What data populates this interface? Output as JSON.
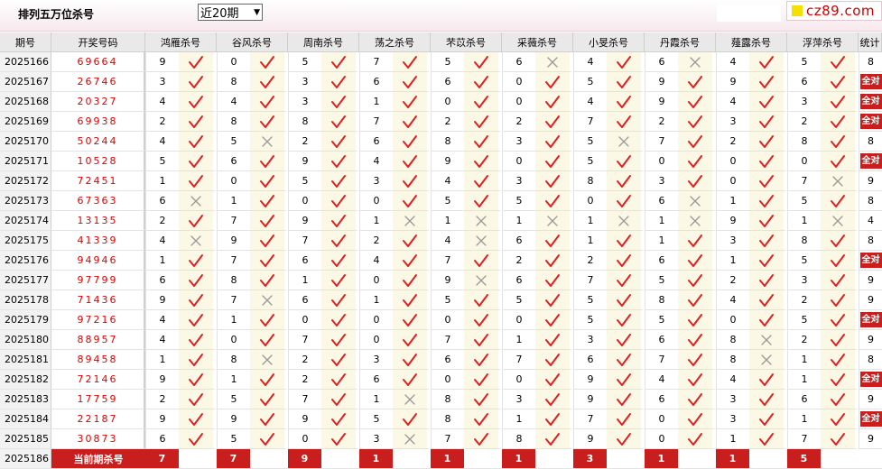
{
  "header": {
    "title": "排列五万位杀号",
    "period_select": "近20期",
    "brand": "cz89.com"
  },
  "columns": {
    "period": "期号",
    "draw": "开奖号码",
    "experts": [
      "鸿雁杀号",
      "谷风杀号",
      "周南杀号",
      "荡之杀号",
      "芣苡杀号",
      "采薇杀号",
      "小旻杀号",
      "丹霞杀号",
      "薤露杀号",
      "浮萍杀号"
    ],
    "stat": "统计"
  },
  "rows": [
    {
      "period": "2025166",
      "draw": "69664",
      "kills": [
        [
          9,
          1
        ],
        [
          0,
          1
        ],
        [
          5,
          1
        ],
        [
          7,
          1
        ],
        [
          5,
          1
        ],
        [
          6,
          0
        ],
        [
          4,
          1
        ],
        [
          6,
          0
        ],
        [
          4,
          1
        ],
        [
          5,
          1
        ]
      ],
      "stat": "8"
    },
    {
      "period": "2025167",
      "draw": "26746",
      "kills": [
        [
          3,
          1
        ],
        [
          8,
          1
        ],
        [
          3,
          1
        ],
        [
          6,
          1
        ],
        [
          6,
          1
        ],
        [
          0,
          1
        ],
        [
          5,
          1
        ],
        [
          9,
          1
        ],
        [
          9,
          1
        ],
        [
          6,
          1
        ]
      ],
      "stat": "全对"
    },
    {
      "period": "2025168",
      "draw": "20327",
      "kills": [
        [
          4,
          1
        ],
        [
          4,
          1
        ],
        [
          3,
          1
        ],
        [
          1,
          1
        ],
        [
          0,
          1
        ],
        [
          0,
          1
        ],
        [
          4,
          1
        ],
        [
          9,
          1
        ],
        [
          4,
          1
        ],
        [
          3,
          1
        ]
      ],
      "stat": "全对"
    },
    {
      "period": "2025169",
      "draw": "69938",
      "kills": [
        [
          2,
          1
        ],
        [
          8,
          1
        ],
        [
          8,
          1
        ],
        [
          7,
          1
        ],
        [
          2,
          1
        ],
        [
          2,
          1
        ],
        [
          7,
          1
        ],
        [
          2,
          1
        ],
        [
          3,
          1
        ],
        [
          2,
          1
        ]
      ],
      "stat": "全对"
    },
    {
      "period": "2025170",
      "draw": "50244",
      "kills": [
        [
          4,
          1
        ],
        [
          5,
          0
        ],
        [
          2,
          1
        ],
        [
          6,
          1
        ],
        [
          8,
          1
        ],
        [
          3,
          1
        ],
        [
          5,
          0
        ],
        [
          7,
          1
        ],
        [
          2,
          1
        ],
        [
          8,
          1
        ]
      ],
      "stat": "8"
    },
    {
      "period": "2025171",
      "draw": "10528",
      "kills": [
        [
          5,
          1
        ],
        [
          6,
          1
        ],
        [
          9,
          1
        ],
        [
          4,
          1
        ],
        [
          9,
          1
        ],
        [
          0,
          1
        ],
        [
          5,
          1
        ],
        [
          0,
          1
        ],
        [
          0,
          1
        ],
        [
          0,
          1
        ]
      ],
      "stat": "全对"
    },
    {
      "period": "2025172",
      "draw": "72451",
      "kills": [
        [
          1,
          1
        ],
        [
          0,
          1
        ],
        [
          5,
          1
        ],
        [
          3,
          1
        ],
        [
          4,
          1
        ],
        [
          3,
          1
        ],
        [
          8,
          1
        ],
        [
          3,
          1
        ],
        [
          0,
          1
        ],
        [
          7,
          0
        ]
      ],
      "stat": "9"
    },
    {
      "period": "2025173",
      "draw": "67363",
      "kills": [
        [
          6,
          0
        ],
        [
          1,
          1
        ],
        [
          0,
          1
        ],
        [
          0,
          1
        ],
        [
          5,
          1
        ],
        [
          5,
          1
        ],
        [
          0,
          1
        ],
        [
          6,
          0
        ],
        [
          1,
          1
        ],
        [
          5,
          1
        ]
      ],
      "stat": "8"
    },
    {
      "period": "2025174",
      "draw": "13135",
      "kills": [
        [
          2,
          1
        ],
        [
          7,
          1
        ],
        [
          9,
          1
        ],
        [
          1,
          0
        ],
        [
          1,
          0
        ],
        [
          1,
          0
        ],
        [
          1,
          0
        ],
        [
          1,
          0
        ],
        [
          9,
          1
        ],
        [
          1,
          0
        ]
      ],
      "stat": "4"
    },
    {
      "period": "2025175",
      "draw": "41339",
      "kills": [
        [
          4,
          0
        ],
        [
          9,
          1
        ],
        [
          7,
          1
        ],
        [
          2,
          1
        ],
        [
          4,
          0
        ],
        [
          6,
          1
        ],
        [
          1,
          1
        ],
        [
          1,
          1
        ],
        [
          3,
          1
        ],
        [
          8,
          1
        ]
      ],
      "stat": "8"
    },
    {
      "period": "2025176",
      "draw": "94946",
      "kills": [
        [
          1,
          1
        ],
        [
          7,
          1
        ],
        [
          6,
          1
        ],
        [
          4,
          1
        ],
        [
          7,
          1
        ],
        [
          2,
          1
        ],
        [
          2,
          1
        ],
        [
          6,
          1
        ],
        [
          1,
          1
        ],
        [
          5,
          1
        ]
      ],
      "stat": "全对"
    },
    {
      "period": "2025177",
      "draw": "97799",
      "kills": [
        [
          6,
          1
        ],
        [
          8,
          1
        ],
        [
          1,
          1
        ],
        [
          0,
          1
        ],
        [
          9,
          0
        ],
        [
          6,
          1
        ],
        [
          7,
          1
        ],
        [
          5,
          1
        ],
        [
          2,
          1
        ],
        [
          3,
          1
        ]
      ],
      "stat": "9"
    },
    {
      "period": "2025178",
      "draw": "71436",
      "kills": [
        [
          9,
          1
        ],
        [
          7,
          0
        ],
        [
          6,
          1
        ],
        [
          1,
          1
        ],
        [
          5,
          1
        ],
        [
          5,
          1
        ],
        [
          5,
          1
        ],
        [
          8,
          1
        ],
        [
          4,
          1
        ],
        [
          2,
          1
        ]
      ],
      "stat": "9"
    },
    {
      "period": "2025179",
      "draw": "97216",
      "kills": [
        [
          4,
          1
        ],
        [
          1,
          1
        ],
        [
          0,
          1
        ],
        [
          0,
          1
        ],
        [
          0,
          1
        ],
        [
          0,
          1
        ],
        [
          5,
          1
        ],
        [
          5,
          1
        ],
        [
          0,
          1
        ],
        [
          5,
          1
        ]
      ],
      "stat": "全对"
    },
    {
      "period": "2025180",
      "draw": "88957",
      "kills": [
        [
          4,
          1
        ],
        [
          0,
          1
        ],
        [
          7,
          1
        ],
        [
          0,
          1
        ],
        [
          7,
          1
        ],
        [
          1,
          1
        ],
        [
          3,
          1
        ],
        [
          6,
          1
        ],
        [
          8,
          0
        ],
        [
          2,
          1
        ]
      ],
      "stat": "9"
    },
    {
      "period": "2025181",
      "draw": "89458",
      "kills": [
        [
          1,
          1
        ],
        [
          8,
          0
        ],
        [
          2,
          1
        ],
        [
          3,
          1
        ],
        [
          6,
          1
        ],
        [
          7,
          1
        ],
        [
          6,
          1
        ],
        [
          7,
          1
        ],
        [
          8,
          0
        ],
        [
          1,
          1
        ]
      ],
      "stat": "8"
    },
    {
      "period": "2025182",
      "draw": "72146",
      "kills": [
        [
          9,
          1
        ],
        [
          1,
          1
        ],
        [
          2,
          1
        ],
        [
          6,
          1
        ],
        [
          0,
          1
        ],
        [
          0,
          1
        ],
        [
          9,
          1
        ],
        [
          4,
          1
        ],
        [
          4,
          1
        ],
        [
          1,
          1
        ]
      ],
      "stat": "全对"
    },
    {
      "period": "2025183",
      "draw": "17759",
      "kills": [
        [
          2,
          1
        ],
        [
          5,
          1
        ],
        [
          7,
          1
        ],
        [
          1,
          0
        ],
        [
          8,
          1
        ],
        [
          3,
          1
        ],
        [
          9,
          1
        ],
        [
          6,
          1
        ],
        [
          3,
          1
        ],
        [
          6,
          1
        ]
      ],
      "stat": "9"
    },
    {
      "period": "2025184",
      "draw": "22187",
      "kills": [
        [
          9,
          1
        ],
        [
          9,
          1
        ],
        [
          9,
          1
        ],
        [
          5,
          1
        ],
        [
          8,
          1
        ],
        [
          1,
          1
        ],
        [
          7,
          1
        ],
        [
          0,
          1
        ],
        [
          3,
          1
        ],
        [
          1,
          1
        ]
      ],
      "stat": "全对"
    },
    {
      "period": "2025185",
      "draw": "30873",
      "kills": [
        [
          6,
          1
        ],
        [
          5,
          1
        ],
        [
          0,
          1
        ],
        [
          3,
          0
        ],
        [
          7,
          1
        ],
        [
          8,
          1
        ],
        [
          9,
          1
        ],
        [
          0,
          1
        ],
        [
          1,
          1
        ],
        [
          7,
          1
        ]
      ],
      "stat": "9"
    }
  ],
  "current": {
    "period": "2025186",
    "label": "当前期杀号",
    "kills": [
      7,
      7,
      9,
      1,
      1,
      1,
      3,
      1,
      1,
      5
    ]
  },
  "colors": {
    "accent": "#c81e1e",
    "draw_text": "#e00000",
    "mark_bg": "#fbf8e6",
    "check": "#e02020",
    "cross": "#999999"
  },
  "icons": {
    "hit": "check-icon",
    "miss": "cross-icon"
  }
}
